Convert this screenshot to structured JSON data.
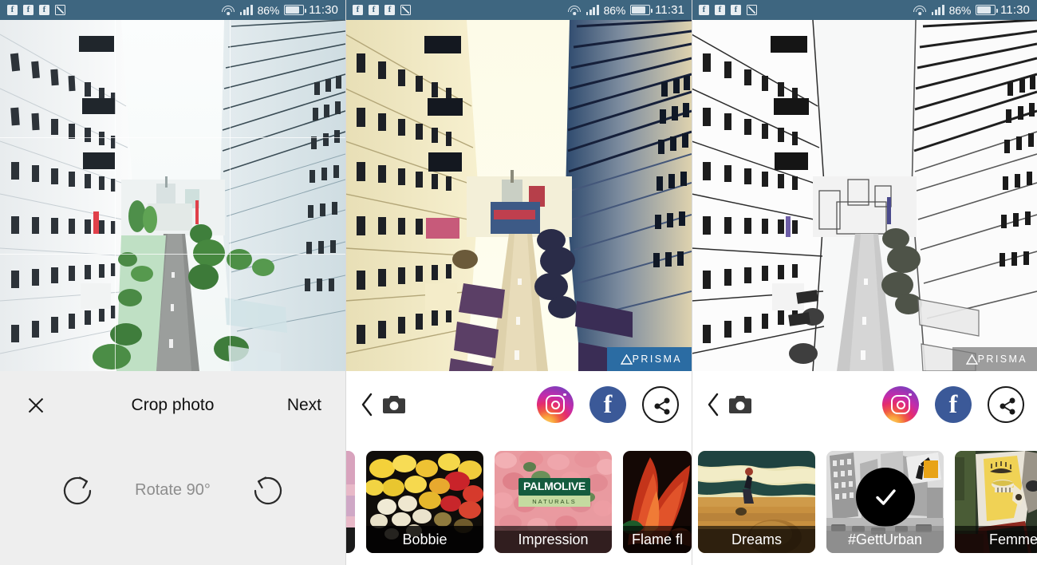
{
  "panels": [
    {
      "id": "crop-editor",
      "status": {
        "icons": [
          "facebook-icon",
          "facebook-icon",
          "facebook-icon",
          "photo-icon"
        ],
        "wifi": "wifi-icon",
        "signal": "signal-bars-icon",
        "battery_percent": "86%",
        "battery": "battery-icon",
        "time": "11:30"
      },
      "toolbar": {
        "close": "close-icon",
        "title": "Crop photo",
        "next": "Next"
      },
      "rotate": {
        "label": "Rotate 90°",
        "left_icon": "rotate-clockwise-icon",
        "right_icon": "rotate-counterclockwise-icon"
      }
    },
    {
      "id": "prisma-result-color",
      "status": {
        "battery_percent": "86%",
        "time": "11:31"
      },
      "watermark": "PRISMA",
      "tools": {
        "back": "chevron-left-icon",
        "camera": "camera-icon",
        "instagram": "instagram-icon",
        "facebook": "facebook-icon",
        "facebook_glyph": "f",
        "share": "share-icon"
      }
    },
    {
      "id": "prisma-result-sketch",
      "status": {
        "battery_percent": "86%",
        "time": "11:30"
      },
      "watermark": "PRISMA",
      "tools": {
        "back": "chevron-left-icon",
        "camera": "camera-icon",
        "instagram": "instagram-icon",
        "facebook": "facebook-icon",
        "facebook_glyph": "f",
        "share": "share-icon"
      }
    }
  ],
  "filters": [
    {
      "name": "",
      "partial": true,
      "selected": false
    },
    {
      "name": "Bobbie",
      "selected": false
    },
    {
      "name": "Impression",
      "selected": false,
      "logo": "PALMOLIVE",
      "logo_sub": "NATURALS"
    },
    {
      "name": "Flame fl",
      "selected": false
    },
    {
      "name": "Dreams",
      "selected": false
    },
    {
      "name": "#GettUrban",
      "selected": true,
      "check": "check-icon"
    },
    {
      "name": "Femme",
      "selected": false
    }
  ],
  "colors": {
    "statusbar": "#3e6680",
    "crop_panel": "#eeeeee",
    "prisma_blue": "#2b6ca3",
    "facebook": "#3b5998",
    "accent_text": "#101010"
  }
}
